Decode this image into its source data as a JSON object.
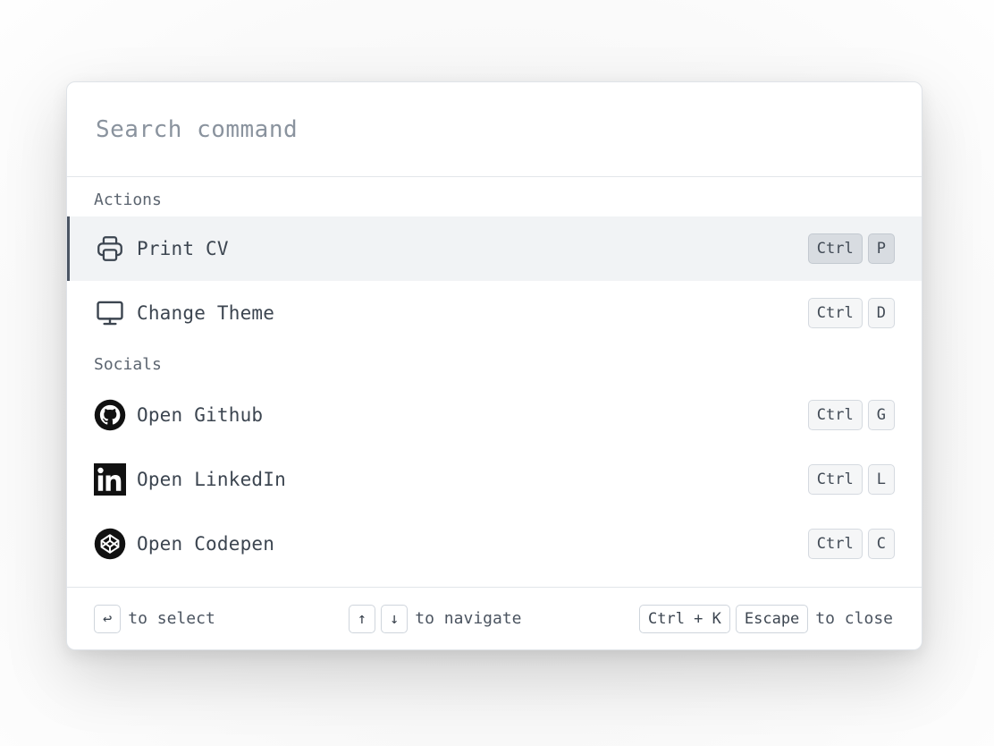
{
  "search": {
    "placeholder": "Search command",
    "value": ""
  },
  "sections": [
    {
      "label": "Actions",
      "items": [
        {
          "label": "Print CV",
          "icon": "printer-icon",
          "keys": [
            "Ctrl",
            "P"
          ],
          "active": true
        },
        {
          "label": "Change Theme",
          "icon": "monitor-icon",
          "keys": [
            "Ctrl",
            "D"
          ],
          "active": false
        }
      ]
    },
    {
      "label": "Socials",
      "items": [
        {
          "label": "Open Github",
          "icon": "github-icon",
          "keys": [
            "Ctrl",
            "G"
          ],
          "active": false
        },
        {
          "label": "Open LinkedIn",
          "icon": "linkedin-icon",
          "keys": [
            "Ctrl",
            "L"
          ],
          "active": false
        },
        {
          "label": "Open Codepen",
          "icon": "codepen-icon",
          "keys": [
            "Ctrl",
            "C"
          ],
          "active": false
        }
      ]
    }
  ],
  "footer": {
    "select_key": "↩",
    "select_text": "to select",
    "nav_up_key": "↑",
    "nav_down_key": "↓",
    "nav_text": "to navigate",
    "close_key_1": "Ctrl + K",
    "close_key_2": "Escape",
    "close_text": "to close"
  },
  "colors": {
    "active_row_bg": "#f1f3f5",
    "active_indicator": "#4b5563",
    "text": "#3c4550"
  }
}
